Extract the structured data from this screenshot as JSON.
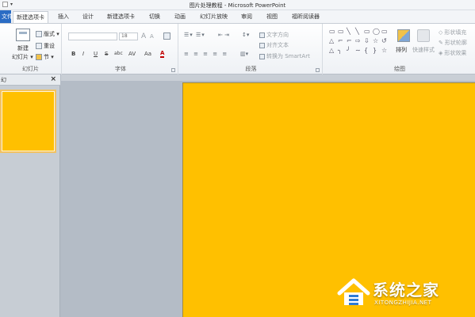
{
  "window": {
    "title": "图片处理教程 - Microsoft PowerPoint",
    "qat_dropdown": "▾"
  },
  "tabs": [
    "文件",
    "新建选项卡",
    "插入",
    "设计",
    "新建选项卡",
    "切换",
    "动画",
    "幻灯片放映",
    "审阅",
    "视图",
    "福昕阅读器"
  ],
  "active_tab_index": 1,
  "ribbon": {
    "slides_group": {
      "label": "幻灯片",
      "new_slide_top": "新建",
      "new_slide_bottom": "幻灯片 ▾",
      "layout": "版式 ▾",
      "reset": "重设",
      "section": "节 ▾"
    },
    "font_group": {
      "label": "字体",
      "font_name": "",
      "font_size": "18",
      "grow": "A",
      "shrink": "A",
      "bold": "B",
      "italic": "I",
      "underline": "U",
      "strike": "S",
      "shadow": "abc",
      "spacing": "AV",
      "case": "Aa",
      "color": "A"
    },
    "paragraph_group": {
      "label": "段落",
      "text_direction": "文字方向",
      "align_text": "对齐文本",
      "smartart": "转换为 SmartArt"
    },
    "drawing_group": {
      "label": "绘图",
      "shapes": [
        "▭",
        "▭",
        "╲",
        "╲",
        "▭",
        "◯",
        "▭",
        "△",
        "⌐",
        "⌐",
        "⇨",
        "⇩",
        "☆",
        "↺",
        "△",
        "╮",
        "╯",
        "∼",
        "{",
        "}",
        "☆"
      ],
      "arrange": "排列",
      "quick_styles": "快速样式",
      "shape_fill": "形状填充",
      "shape_outline": "形状轮廓",
      "shape_effects": "形状效果"
    }
  },
  "left_pane": {
    "tab_label": "幻",
    "close": "×"
  },
  "slide": {
    "background_color": "#FFC000"
  },
  "watermark": {
    "brand": "系统之家",
    "url": "XITONGZHIJIA.NET"
  }
}
